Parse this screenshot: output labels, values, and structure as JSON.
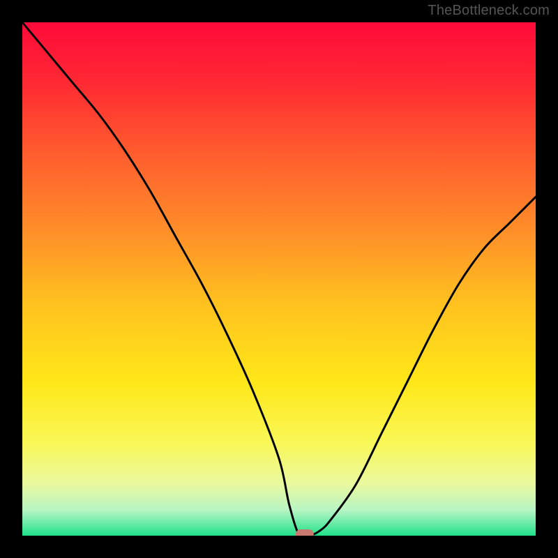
{
  "watermark": "TheBottleneck.com",
  "chart_data": {
    "type": "line",
    "title": "",
    "xlabel": "",
    "ylabel": "",
    "xlim": [
      0,
      100
    ],
    "ylim": [
      0,
      100
    ],
    "x": [
      0,
      5,
      10,
      15,
      20,
      25,
      30,
      35,
      40,
      45,
      50,
      52,
      54,
      56,
      58,
      60,
      65,
      70,
      75,
      80,
      85,
      90,
      95,
      100
    ],
    "values": [
      100,
      94,
      88,
      82,
      75,
      67,
      58,
      49,
      39,
      28,
      15,
      6,
      0,
      0,
      1,
      3,
      10,
      20,
      30,
      40,
      49,
      56,
      61,
      66
    ],
    "marker": {
      "x": 55,
      "y": 0
    },
    "gradient_stops": [
      {
        "offset": 0.0,
        "color": "#ff0a3a"
      },
      {
        "offset": 0.12,
        "color": "#ff2a33"
      },
      {
        "offset": 0.25,
        "color": "#ff5b2e"
      },
      {
        "offset": 0.4,
        "color": "#ff8c29"
      },
      {
        "offset": 0.55,
        "color": "#ffc21f"
      },
      {
        "offset": 0.7,
        "color": "#ffe718"
      },
      {
        "offset": 0.82,
        "color": "#f9f858"
      },
      {
        "offset": 0.9,
        "color": "#e9f9a0"
      },
      {
        "offset": 0.95,
        "color": "#b8f5c4"
      },
      {
        "offset": 1.0,
        "color": "#1fe28a"
      }
    ],
    "curve_stroke": "#000000",
    "marker_fill": "#c97a70"
  }
}
